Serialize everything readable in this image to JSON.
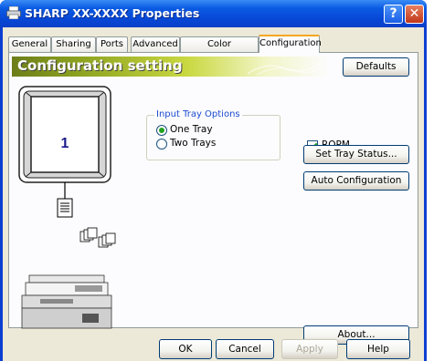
{
  "window": {
    "title": "SHARP XX-XXXX Properties",
    "help_label": "?",
    "close_label": "✕"
  },
  "tabs": [
    {
      "label": "General"
    },
    {
      "label": "Sharing"
    },
    {
      "label": "Ports"
    },
    {
      "label": "Advanced"
    },
    {
      "label": "Color Management"
    },
    {
      "label": "Configuration",
      "active": true
    }
  ],
  "config": {
    "banner_title": "Configuration setting",
    "defaults_label": "Defaults",
    "tray_count_display": "1",
    "input_tray_group": "Input Tray Options",
    "radio_options": [
      {
        "label": "One Tray",
        "checked": true
      },
      {
        "label": "Two Trays",
        "checked": false
      }
    ],
    "ropm": {
      "label": "ROPM",
      "checked": true
    },
    "set_tray_status_label": "Set Tray Status...",
    "auto_config_label": "Auto Configuration",
    "about_label": "About..."
  },
  "footer": {
    "ok": "OK",
    "cancel": "Cancel",
    "apply": "Apply",
    "help": "Help"
  }
}
